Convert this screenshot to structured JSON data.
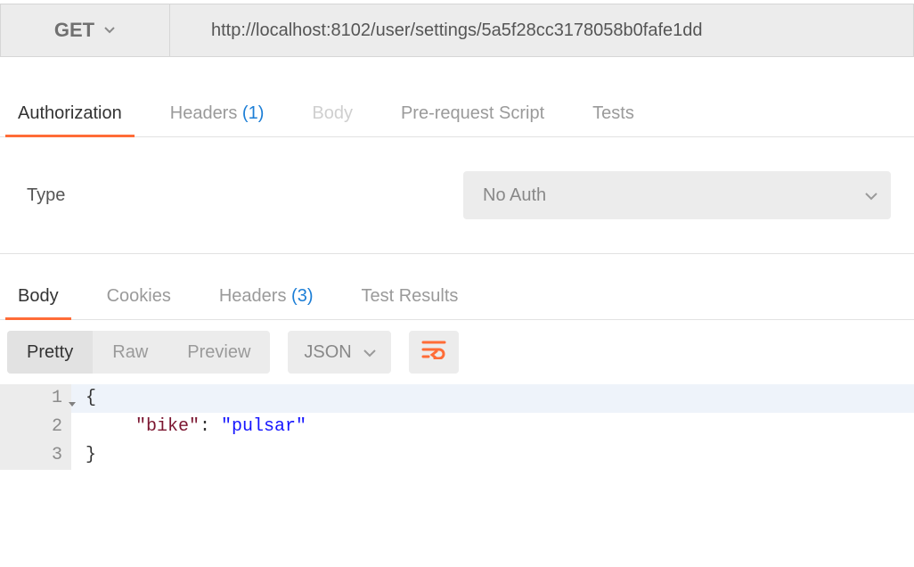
{
  "request": {
    "method": "GET",
    "url": "http://localhost:8102/user/settings/5a5f28cc3178058b0fafe1dd"
  },
  "request_tabs": {
    "authorization": "Authorization",
    "headers": {
      "label": "Headers",
      "count": "(1)"
    },
    "body": "Body",
    "prerequest": "Pre-request Script",
    "tests": "Tests"
  },
  "auth": {
    "type_label": "Type",
    "selected": "No Auth"
  },
  "response_tabs": {
    "body": "Body",
    "cookies": "Cookies",
    "headers": {
      "label": "Headers",
      "count": "(3)"
    },
    "test_results": "Test Results"
  },
  "view_modes": {
    "pretty": "Pretty",
    "raw": "Raw",
    "preview": "Preview"
  },
  "format_select": "JSON",
  "response_body": {
    "lines": [
      "1",
      "2",
      "3"
    ],
    "brace_open": "{",
    "key": "\"bike\"",
    "colon": ": ",
    "value": "\"pulsar\"",
    "brace_close": "}"
  }
}
